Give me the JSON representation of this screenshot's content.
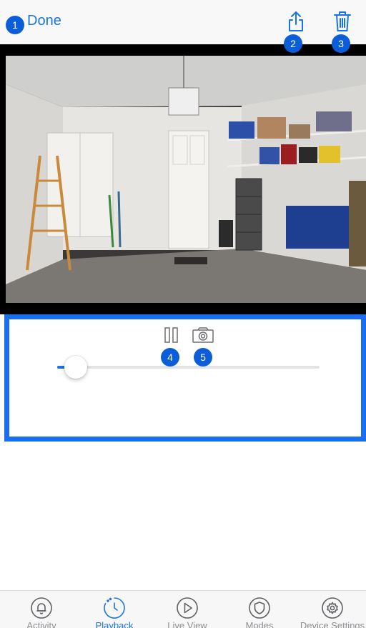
{
  "navbar": {
    "done_label": "Done"
  },
  "annotations": [
    "1",
    "2",
    "3",
    "4",
    "5"
  ],
  "icons": {
    "share": "share-icon",
    "delete": "trash-icon",
    "pause": "pause-icon",
    "snapshot": "camera-icon"
  },
  "playback": {
    "progress": 0.07
  },
  "tabs": [
    {
      "label": "Activity",
      "icon": "bell-icon",
      "active": false
    },
    {
      "label": "Playback",
      "icon": "clock-icon",
      "active": true
    },
    {
      "label": "Live View",
      "icon": "play-icon",
      "active": false
    },
    {
      "label": "Modes",
      "icon": "shield-icon",
      "active": false
    },
    {
      "label": "Device Settings",
      "icon": "gear-icon",
      "active": false
    }
  ],
  "colors": {
    "accent": "#1a73e8",
    "badge": "#0b5ed7",
    "panel_border": "#1a6ef0"
  }
}
